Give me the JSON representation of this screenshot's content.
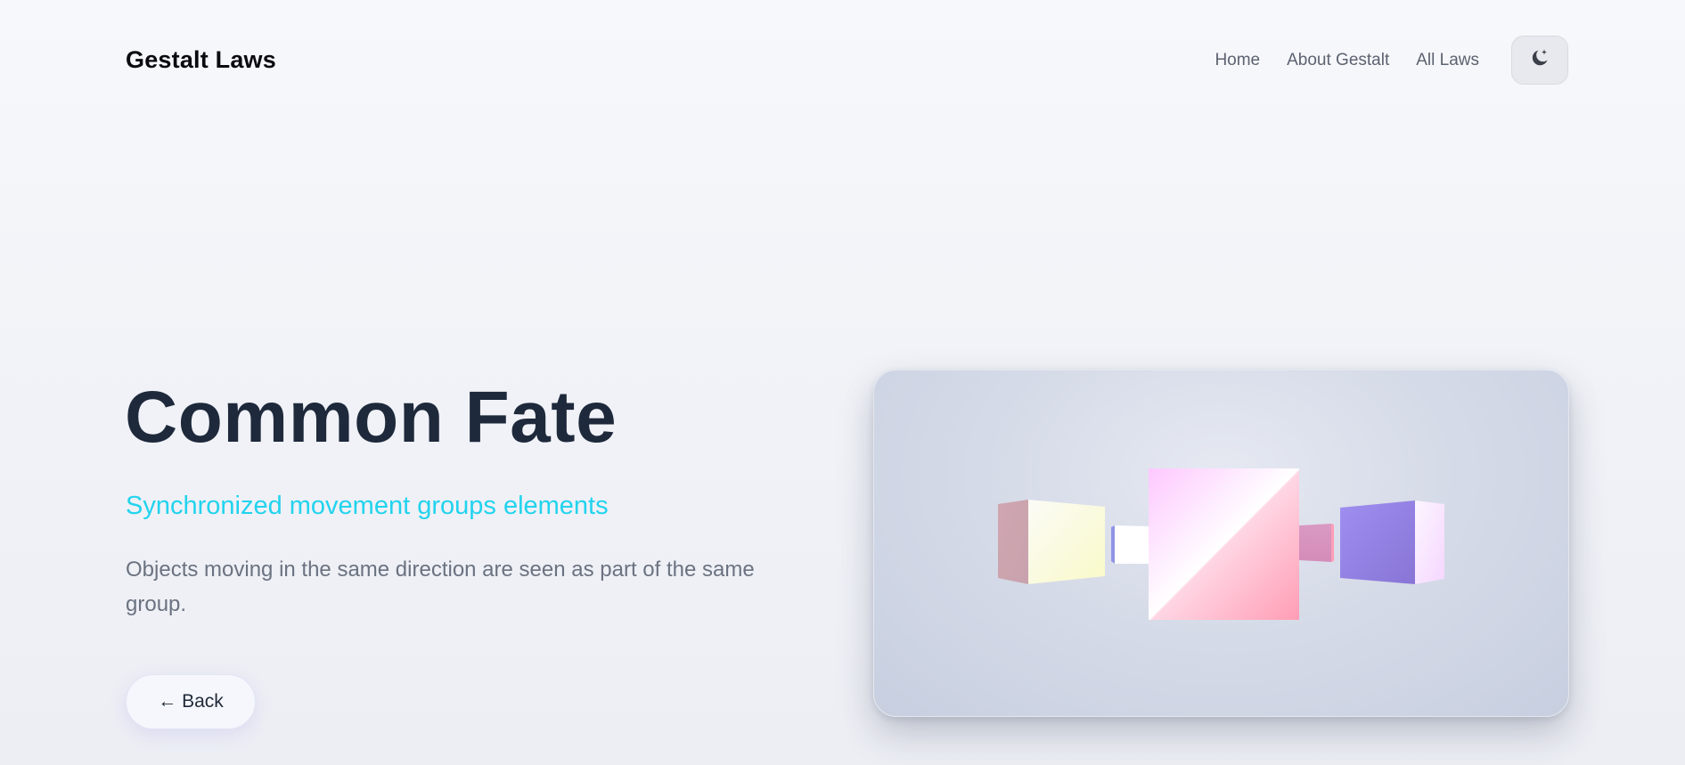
{
  "header": {
    "brand": "Gestalt Laws",
    "nav": [
      {
        "label": "Home"
      },
      {
        "label": "About Gestalt"
      },
      {
        "label": "All Laws"
      }
    ],
    "theme_toggle_icon": "moon-sparkle-icon"
  },
  "hero": {
    "title": "Common Fate",
    "subtitle": "Synchronized movement groups elements",
    "description": "Objects moving in the same direction are seen as part of the same group.",
    "back_button": "← Back"
  },
  "colors": {
    "accent": "#22d3ee",
    "title": "#1e293b",
    "body_text": "#6b7280",
    "nav_text": "#5c6270"
  }
}
